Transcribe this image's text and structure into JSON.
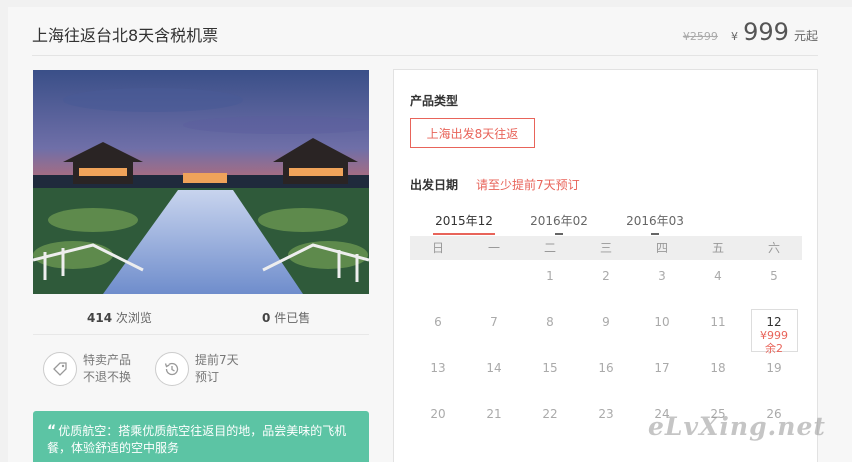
{
  "header": {
    "title": "上海往返台北8天含税机票",
    "old_price": "¥2599",
    "currency": "¥",
    "price": "999",
    "unit": "元起"
  },
  "stats": {
    "views_count": "414",
    "views_label": "次浏览",
    "sold_count": "0",
    "sold_label": "件已售"
  },
  "features": [
    {
      "icon": "tag-icon",
      "line1": "特卖产品",
      "line2": "不退不换"
    },
    {
      "icon": "clock-icon",
      "line1": "提前7天",
      "line2": "预订"
    }
  ],
  "note": {
    "quote": "“",
    "text": "优质航空：搭乘优质航空往返目的地，品尝美味的飞机餐，体验舒适的空中服务"
  },
  "booking": {
    "type_label": "产品类型",
    "type_option": "上海出发8天往返",
    "date_label": "出发日期",
    "date_hint": "请至少提前7天预订",
    "months": [
      "2015年12",
      "2016年02",
      "2016年03"
    ],
    "weekdays": [
      "日",
      "一",
      "二",
      "三",
      "四",
      "五",
      "六"
    ],
    "weeks": [
      [
        "",
        "",
        "1",
        "2",
        "3",
        "4",
        "5"
      ],
      [
        "6",
        "7",
        "8",
        "9",
        "10",
        "11",
        "12"
      ],
      [
        "13",
        "14",
        "15",
        "16",
        "17",
        "18",
        "19"
      ],
      [
        "20",
        "21",
        "22",
        "23",
        "24",
        "25",
        "26"
      ]
    ],
    "special": {
      "day": "12",
      "price": "¥999",
      "remaining": "余2"
    }
  },
  "watermark": "eLvXing.net",
  "colors": {
    "accent": "#e8645a",
    "note_bg": "#5cc4a4"
  }
}
